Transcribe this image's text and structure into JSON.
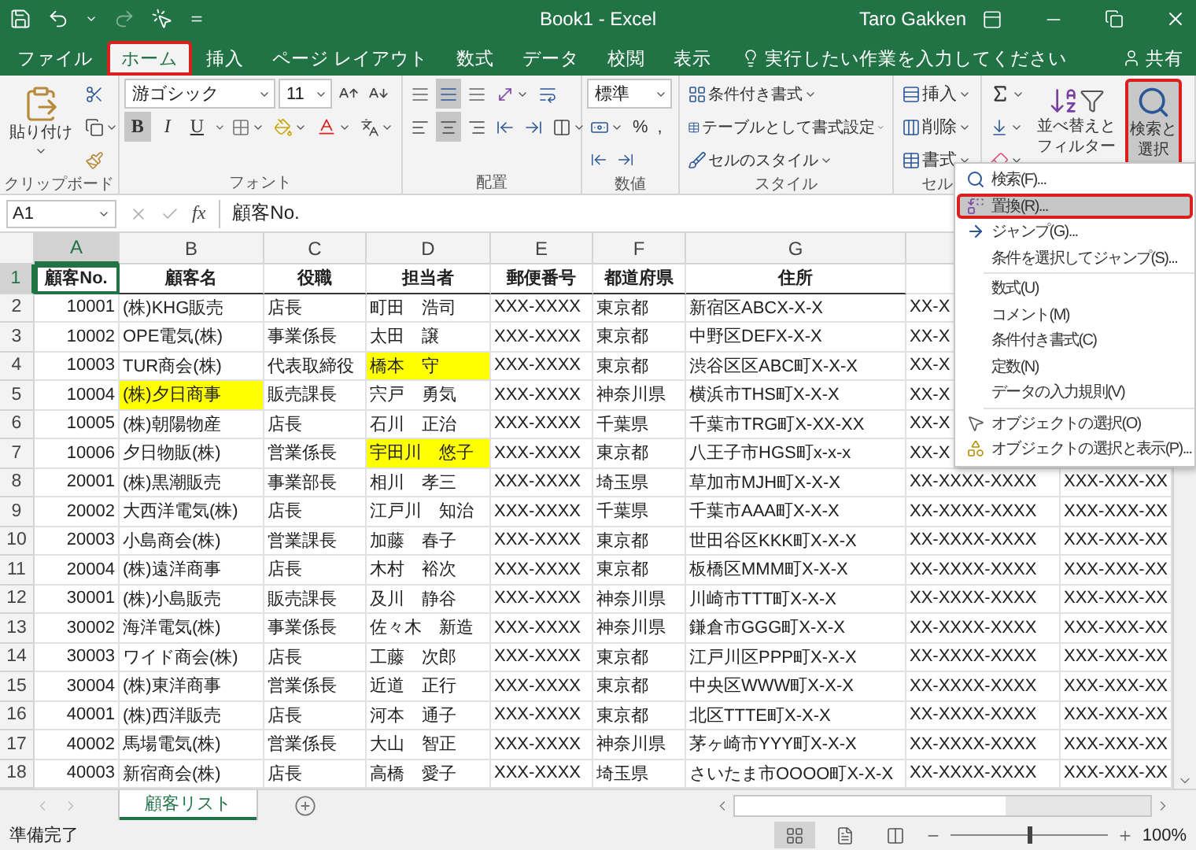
{
  "title_bar": {
    "title": "Book1 - Excel",
    "user": "Taro Gakken"
  },
  "ribbon_tabs": [
    {
      "label": "ファイル",
      "selected": false
    },
    {
      "label": "ホーム",
      "selected": true
    },
    {
      "label": "挿入",
      "selected": false
    },
    {
      "label": "ページ レイアウト",
      "selected": false
    },
    {
      "label": "数式",
      "selected": false
    },
    {
      "label": "データ",
      "selected": false
    },
    {
      "label": "校閲",
      "selected": false
    },
    {
      "label": "表示",
      "selected": false
    }
  ],
  "tell_me": {
    "placeholder": "実行したい作業を入力してください"
  },
  "share": "共有",
  "ribbon": {
    "clipboard": {
      "paste": "貼り付け",
      "label": "クリップボード"
    },
    "font": {
      "font_name": "游ゴシック",
      "font_size": "11",
      "bold": "B",
      "italic": "I",
      "underline": "U",
      "label": "フォント"
    },
    "alignment": {
      "label": "配置"
    },
    "number": {
      "format": "標準",
      "percent": "%",
      "comma": ",",
      "label": "数値"
    },
    "styles": {
      "items": [
        "条件付き書式",
        "テーブルとして書式設定",
        "セルのスタイル"
      ],
      "label": "スタイル"
    },
    "cells": {
      "items": [
        "挿入",
        "削除",
        "書式"
      ],
      "label": "セル"
    },
    "editing": {
      "sort_filter": [
        "並べ替えと",
        "フィルター"
      ],
      "find_select": [
        "検索と",
        "選択"
      ],
      "find_select_pressed": true
    }
  },
  "formula_bar": {
    "name_box": "A1",
    "function_symbol": "fx",
    "formula": "顧客No."
  },
  "sheet": {
    "columns": [
      {
        "label": "A",
        "selected": true
      },
      {
        "label": "B",
        "selected": false
      },
      {
        "label": "C",
        "selected": false
      },
      {
        "label": "D",
        "selected": false
      },
      {
        "label": "E",
        "selected": false
      },
      {
        "label": "F",
        "selected": false
      },
      {
        "label": "G",
        "selected": false
      }
    ],
    "rows": [
      {
        "number": "1",
        "kind": "heading",
        "selected": true,
        "cells": [
          "顧客No.",
          "顧客名",
          "役職",
          "担当者",
          "郵便番号",
          "都道府県",
          "住所"
        ],
        "highlighted": [
          false,
          false,
          false,
          false,
          false,
          false,
          false
        ]
      },
      {
        "number": "2",
        "kind": "data",
        "selected": false,
        "cells": [
          "10001",
          "(株)KHG販売",
          "店長",
          "町田　浩司",
          "XXX-XXXX",
          "東京都",
          "新宿区ABCX-X-X",
          "XX-X"
        ],
        "highlighted": [
          false,
          false,
          false,
          false,
          false,
          false,
          false,
          false
        ]
      },
      {
        "number": "3",
        "kind": "data",
        "selected": false,
        "cells": [
          "10002",
          "OPE電気(株)",
          "事業係長",
          "太田　譲",
          "XXX-XXXX",
          "東京都",
          "中野区DEFX-X-X",
          "XX-X"
        ],
        "highlighted": [
          false,
          false,
          false,
          false,
          false,
          false,
          false,
          false
        ]
      },
      {
        "number": "4",
        "kind": "data",
        "selected": false,
        "cells": [
          "10003",
          "TUR商会(株)",
          "代表取締役",
          "橋本　守",
          "XXX-XXXX",
          "東京都",
          "渋谷区区ABC町X-X-X",
          "XX-X"
        ],
        "highlighted": [
          false,
          false,
          false,
          true,
          false,
          false,
          false,
          false
        ]
      },
      {
        "number": "5",
        "kind": "data",
        "selected": false,
        "cells": [
          "10004",
          "(株)夕日商事",
          "販売課長",
          "宍戸　勇気",
          "XXX-XXXX",
          "神奈川県",
          "横浜市THS町X-X-X",
          "XX-X"
        ],
        "highlighted": [
          false,
          true,
          false,
          false,
          false,
          false,
          false,
          false
        ]
      },
      {
        "number": "6",
        "kind": "data",
        "selected": false,
        "cells": [
          "10005",
          "(株)朝陽物産",
          "店長",
          "石川　正治",
          "XXX-XXXX",
          "千葉県",
          "千葉市TRG町X-XX-XX",
          "XX-X"
        ],
        "highlighted": [
          false,
          false,
          false,
          false,
          false,
          false,
          false,
          false
        ]
      },
      {
        "number": "7",
        "kind": "data",
        "selected": false,
        "cells": [
          "10006",
          "夕日物販(株)",
          "営業係長",
          "宇田川　悠子",
          "XXX-XXXX",
          "東京都",
          "八王子市HGS町x-x-x",
          "XX-X"
        ],
        "highlighted": [
          false,
          false,
          false,
          true,
          false,
          false,
          false,
          false
        ]
      },
      {
        "number": "8",
        "kind": "data",
        "selected": false,
        "cells": [
          "20001",
          "(株)黒潮販売",
          "事業部長",
          "相川　孝三",
          "XXX-XXXX",
          "埼玉県",
          "草加市MJH町X-X-X",
          "XX-XXXX-XXXX",
          "XXX-XXX-XX"
        ],
        "highlighted": [
          false,
          false,
          false,
          false,
          false,
          false,
          false,
          false,
          false
        ]
      },
      {
        "number": "9",
        "kind": "data",
        "selected": false,
        "cells": [
          "20002",
          "大西洋電気(株)",
          "店長",
          "江戸川　知治",
          "XXX-XXXX",
          "千葉県",
          "千葉市AAA町X-X-X",
          "XX-XXXX-XXXX",
          "XXX-XXX-XX"
        ],
        "highlighted": [
          false,
          false,
          false,
          false,
          false,
          false,
          false,
          false,
          false
        ]
      },
      {
        "number": "10",
        "kind": "data",
        "selected": false,
        "cells": [
          "20003",
          "小島商会(株)",
          "営業課長",
          "加藤　春子",
          "XXX-XXXX",
          "東京都",
          "世田谷区KKK町X-X-X",
          "XX-XXXX-XXXX",
          "XXX-XXX-XX"
        ],
        "highlighted": [
          false,
          false,
          false,
          false,
          false,
          false,
          false,
          false,
          false
        ]
      },
      {
        "number": "11",
        "kind": "data",
        "selected": false,
        "cells": [
          "20004",
          "(株)遠洋商事",
          "店長",
          "木村　裕次",
          "XXX-XXXX",
          "東京都",
          "板橋区MMM町X-X-X",
          "XX-XXXX-XXXX",
          "XXX-XXX-XX"
        ],
        "highlighted": [
          false,
          false,
          false,
          false,
          false,
          false,
          false,
          false,
          false
        ]
      },
      {
        "number": "12",
        "kind": "data",
        "selected": false,
        "cells": [
          "30001",
          "(株)小島販売",
          "販売課長",
          "及川　静谷",
          "XXX-XXXX",
          "神奈川県",
          "川崎市TTT町X-X-X",
          "XX-XXXX-XXXX",
          "XXX-XXX-XX"
        ],
        "highlighted": [
          false,
          false,
          false,
          false,
          false,
          false,
          false,
          false,
          false
        ]
      },
      {
        "number": "13",
        "kind": "data",
        "selected": false,
        "cells": [
          "30002",
          "海洋電気(株)",
          "事業係長",
          "佐々木　新造",
          "XXX-XXXX",
          "神奈川県",
          "鎌倉市GGG町X-X-X",
          "XX-XXXX-XXXX",
          "XXX-XXX-XX"
        ],
        "highlighted": [
          false,
          false,
          false,
          false,
          false,
          false,
          false,
          false,
          false
        ]
      },
      {
        "number": "14",
        "kind": "data",
        "selected": false,
        "cells": [
          "30003",
          "ワイド商会(株)",
          "店長",
          "工藤　次郎",
          "XXX-XXXX",
          "東京都",
          "江戸川区PPP町X-X-X",
          "XX-XXXX-XXXX",
          "XXX-XXX-XX"
        ],
        "highlighted": [
          false,
          false,
          false,
          false,
          false,
          false,
          false,
          false,
          false
        ]
      },
      {
        "number": "15",
        "kind": "data",
        "selected": false,
        "cells": [
          "30004",
          "(株)東洋商事",
          "営業係長",
          "近道　正行",
          "XXX-XXXX",
          "東京都",
          "中央区WWW町X-X-X",
          "XX-XXXX-XXXX",
          "XXX-XXX-XX"
        ],
        "highlighted": [
          false,
          false,
          false,
          false,
          false,
          false,
          false,
          false,
          false
        ]
      },
      {
        "number": "16",
        "kind": "data",
        "selected": false,
        "cells": [
          "40001",
          "(株)西洋販売",
          "店長",
          "河本　通子",
          "XXX-XXXX",
          "東京都",
          "北区TTTE町X-X-X",
          "XX-XXXX-XXXX",
          "XXX-XXX-XX"
        ],
        "highlighted": [
          false,
          false,
          false,
          false,
          false,
          false,
          false,
          false,
          false
        ]
      },
      {
        "number": "17",
        "kind": "data",
        "selected": false,
        "cells": [
          "40002",
          "馬場電気(株)",
          "営業係長",
          "大山　智正",
          "XXX-XXXX",
          "神奈川県",
          "茅ヶ崎市YYY町X-X-X",
          "XX-XXXX-XXXX",
          "XXX-XXX-XX"
        ],
        "highlighted": [
          false,
          false,
          false,
          false,
          false,
          false,
          false,
          false,
          false
        ]
      },
      {
        "number": "18",
        "kind": "data",
        "selected": false,
        "cells": [
          "40003",
          "新宿商会(株)",
          "店長",
          "高橋　愛子",
          "XXX-XXXX",
          "埼玉県",
          "さいたま市OOOO町X-X-X",
          "XX-XXXX-XXXX",
          "XXX-XXX-XX"
        ],
        "highlighted": [
          false,
          false,
          false,
          false,
          false,
          false,
          false,
          false,
          false
        ]
      }
    ]
  },
  "find_menu": {
    "sections": [
      [
        {
          "label": "検索(F)...",
          "kind": "search",
          "selected": false
        },
        {
          "label": "置換(R)...",
          "kind": "replace",
          "selected": true
        },
        {
          "label": "ジャンプ(G)...",
          "kind": "jump",
          "selected": false
        },
        {
          "label": "条件を選択してジャンプ(S)...",
          "kind": "plain",
          "selected": false
        }
      ],
      [
        {
          "label": "数式(U)",
          "kind": "plain",
          "selected": false
        },
        {
          "label": "コメント(M)",
          "kind": "plain",
          "selected": false
        },
        {
          "label": "条件付き書式(C)",
          "kind": "plain",
          "selected": false
        },
        {
          "label": "定数(N)",
          "kind": "plain",
          "selected": false
        },
        {
          "label": "データの入力規則(V)",
          "kind": "plain",
          "selected": false
        }
      ],
      [
        {
          "label": "オブジェクトの選択(O)",
          "kind": "pointer",
          "selected": false
        },
        {
          "label": "オブジェクトの選択と表示(P)...",
          "kind": "objects",
          "selected": false
        }
      ]
    ]
  },
  "sheet_tabs": [
    {
      "label": "顧客リスト",
      "selected": true
    }
  ],
  "status_bar": {
    "status": "準備完了",
    "views": [
      {
        "kind": "normal",
        "selected": true
      },
      {
        "kind": "page_layout",
        "selected": false
      },
      {
        "kind": "page_break",
        "selected": false
      }
    ],
    "zoom": {
      "level": 0.5,
      "reading": "100%"
    }
  }
}
